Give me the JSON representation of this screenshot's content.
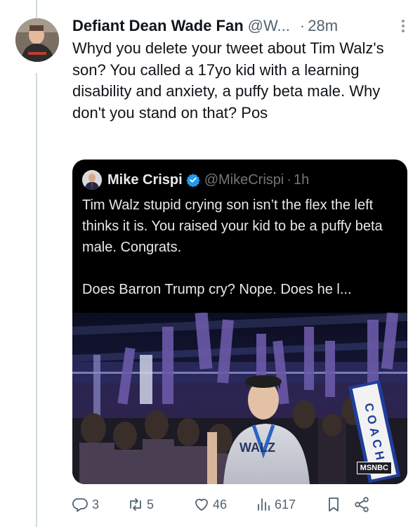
{
  "tweet": {
    "display_name": "Defiant Dean Wade Fan",
    "handle": "@W...",
    "separator": "·",
    "time": "28m",
    "text": "Whyd you delete your tweet about Tim Walz's son? You called a 17yo kid with a learning disability and anxiety, a puffy beta male. Why don't you stand on that? Pos"
  },
  "quote": {
    "display_name": "Mike Crispi",
    "handle": "@MikeCrispi",
    "separator": "·",
    "time": "1h",
    "text": "Tim Walz stupid crying son isn’t the flex the left thinks it is. You raised your kid to be a puffy beta male. Congrats.\n\nDoes Barron Trump cry? Nope. Does he l...",
    "media": {
      "sign_coach": "COACH",
      "shirt_text": "WALZ",
      "network_logo": "MSNBC"
    }
  },
  "actions": {
    "replies": "3",
    "reposts": "5",
    "likes": "46",
    "views": "617"
  },
  "colors": {
    "text": "#0f1419",
    "secondary": "#536471",
    "verified": "#1d9bf0",
    "quote_bg": "#000000"
  }
}
